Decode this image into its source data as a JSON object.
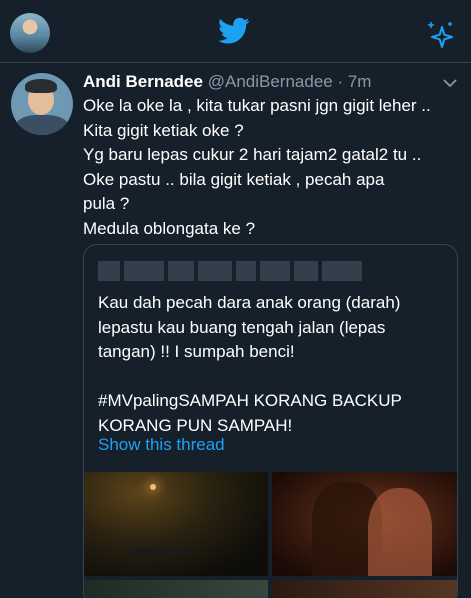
{
  "header": {
    "logo_icon": "twitter-bird-icon",
    "sparkle_icon": "sparkle-icon",
    "accent_color": "#1da1f2"
  },
  "tweet": {
    "display_name": "Andi Bernadee",
    "handle": "@AndiBernadee",
    "time": "· 7m",
    "lines": [
      "Oke la oke la , kita tukar pasni jgn gigit leher ..",
      "Kita gigit ketiak oke ?",
      "Yg baru lepas cukur 2 hari tajam2 gatal2 tu ..",
      "Oke pastu .. bila gigit ketiak , pecah apa",
      "pula ?",
      "Medula oblongata ke ?"
    ]
  },
  "quote": {
    "lines": [
      "Kau dah pecah dara anak orang (darah)",
      "lepastu kau buang tengah jalan (lepas",
      "tangan) !! I sumpah benci!",
      "",
      "#MVpalingSAMPAH KORANG BACKUP",
      "KORANG PUN SAMPAH!"
    ],
    "show_thread": "Show this thread"
  },
  "colors": {
    "background": "#15202b",
    "border": "#38444d",
    "secondary_text": "#8899a6",
    "link": "#1da1f2"
  }
}
